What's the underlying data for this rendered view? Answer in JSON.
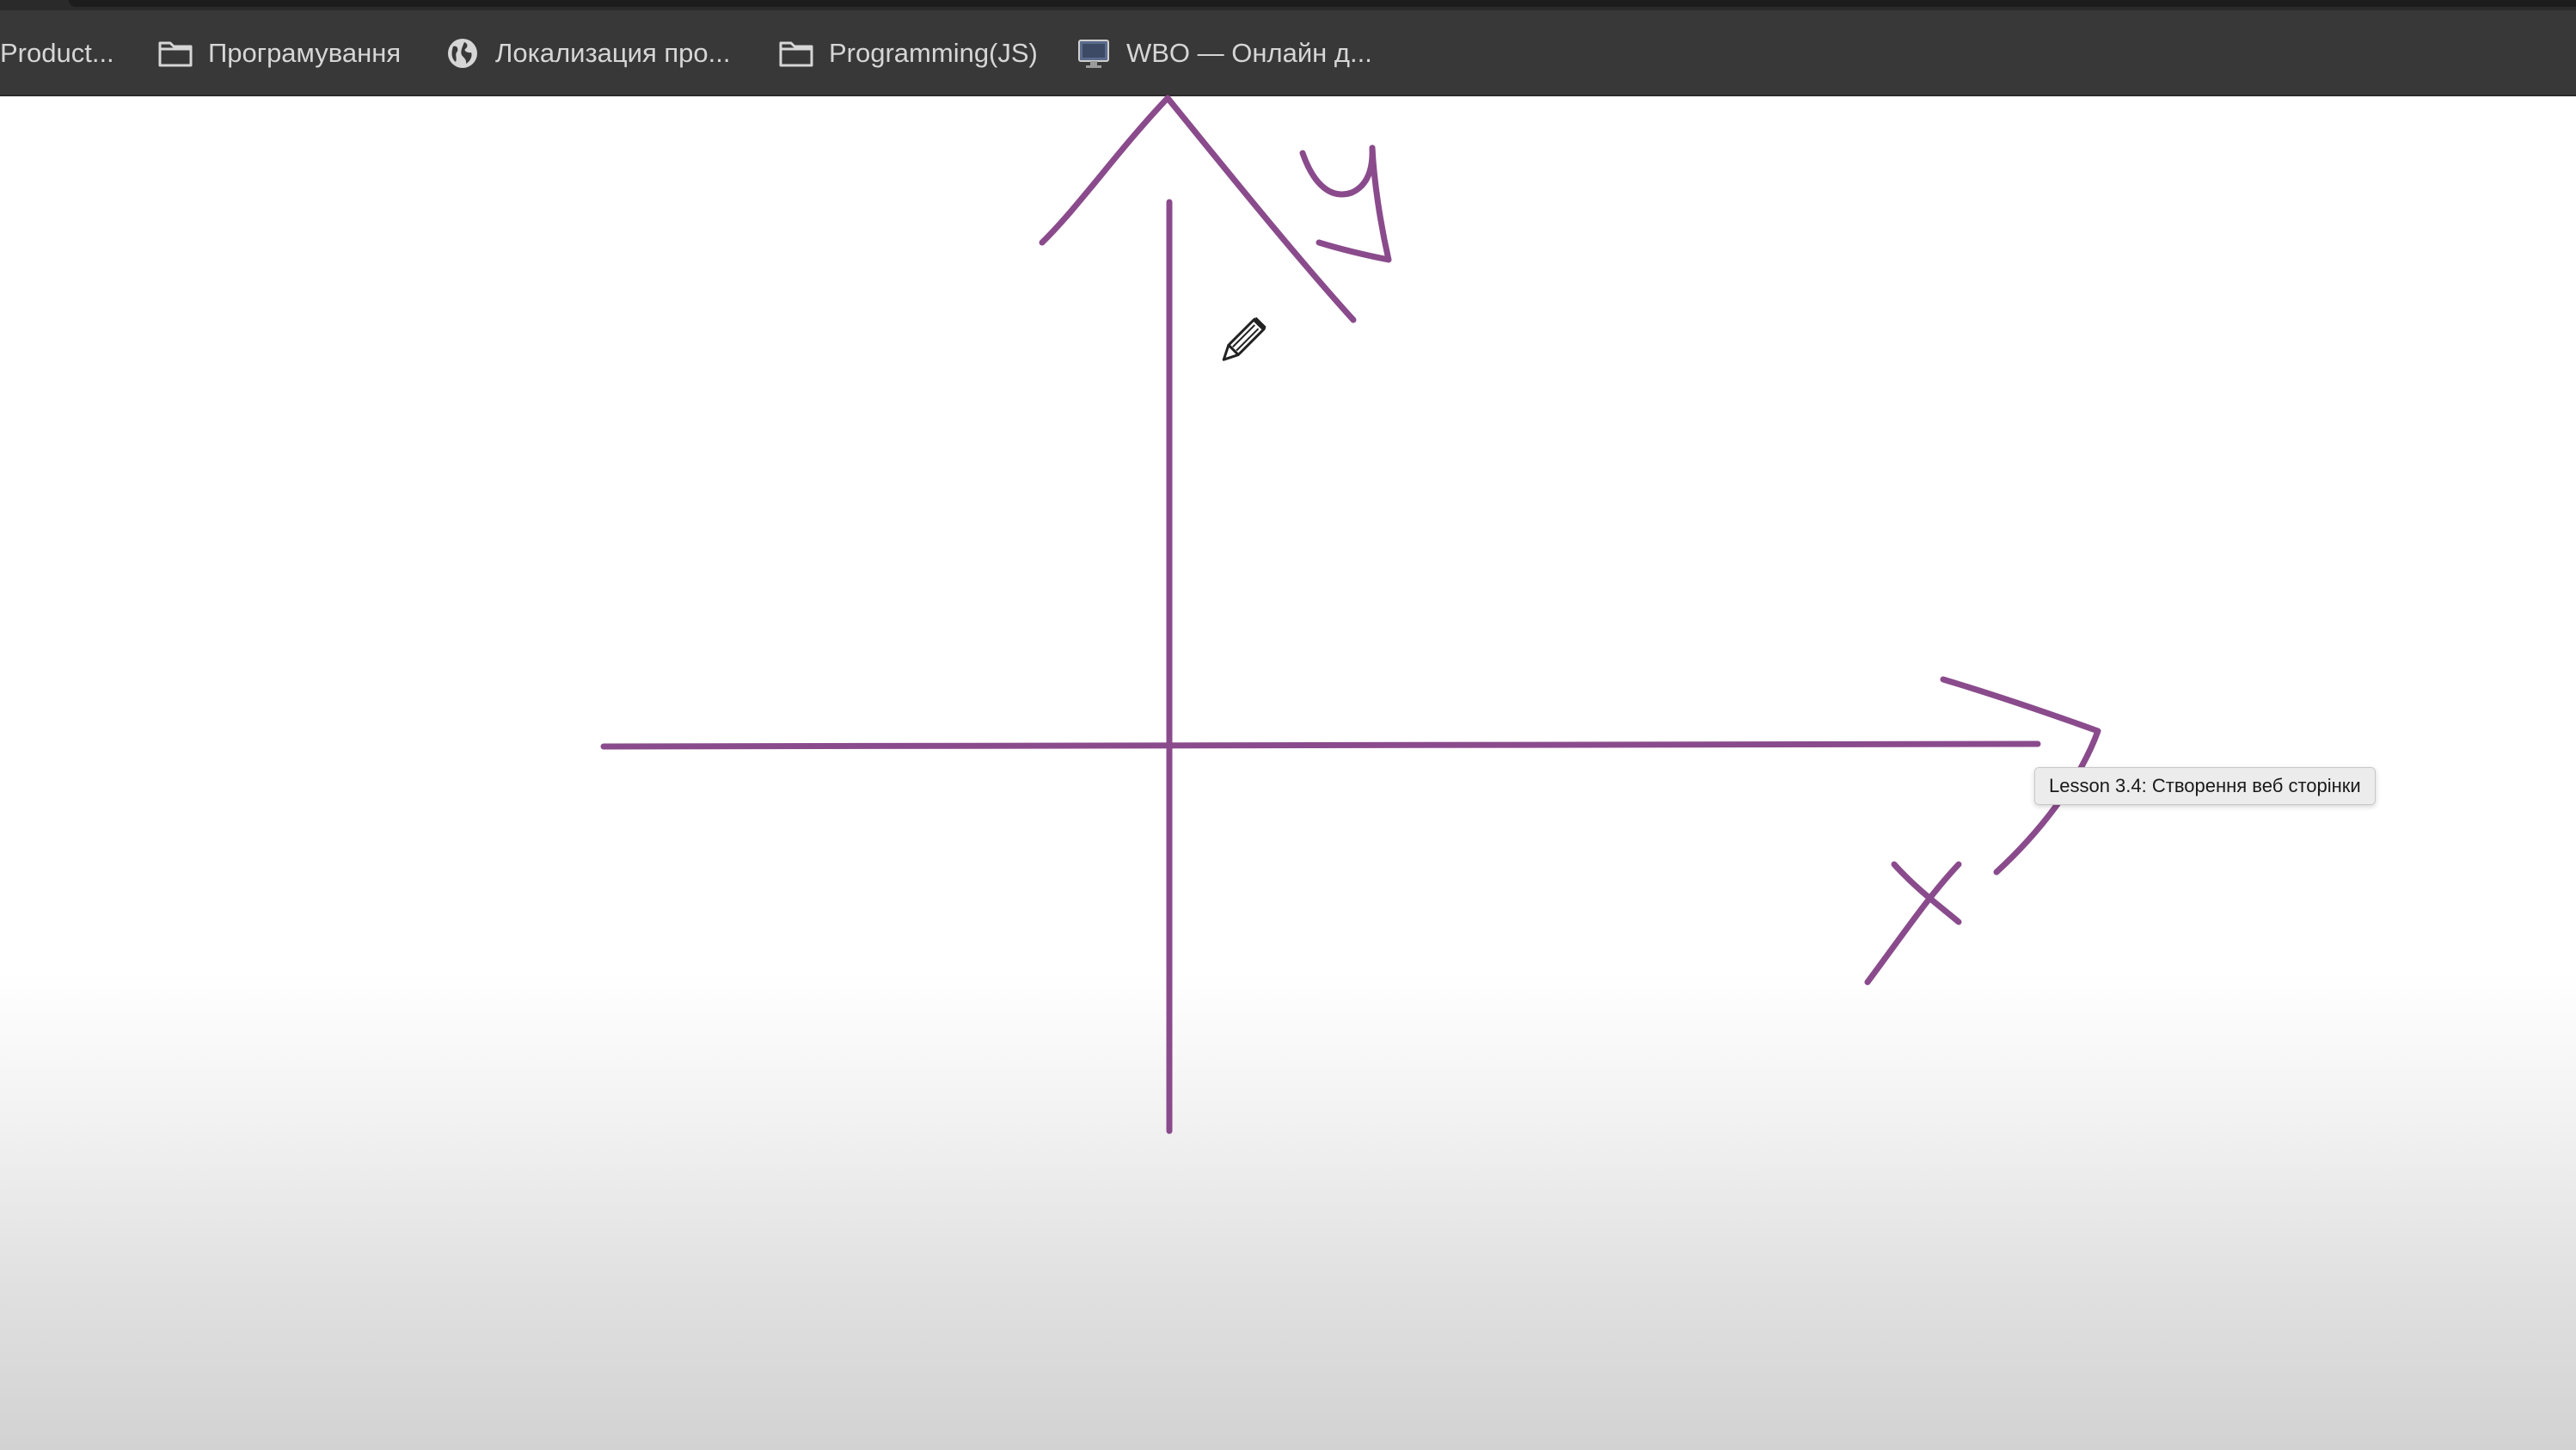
{
  "bookmarks_bar": {
    "items": [
      {
        "label": "Product...",
        "icon": "none"
      },
      {
        "label": "Програмування",
        "icon": "folder-icon"
      },
      {
        "label": "Локализация про...",
        "icon": "globe-icon"
      },
      {
        "label": "Programming(JS)",
        "icon": "folder-icon"
      },
      {
        "label": "WBO — Онлайн д...",
        "icon": "monitor-icon"
      }
    ]
  },
  "whiteboard": {
    "stroke_color": "#8a4b8c",
    "axis_labels": {
      "y": "y",
      "x": "x"
    },
    "cursor": "pencil-icon"
  },
  "tooltip": {
    "text": "Lesson 3.4: Створення веб сторінки"
  }
}
